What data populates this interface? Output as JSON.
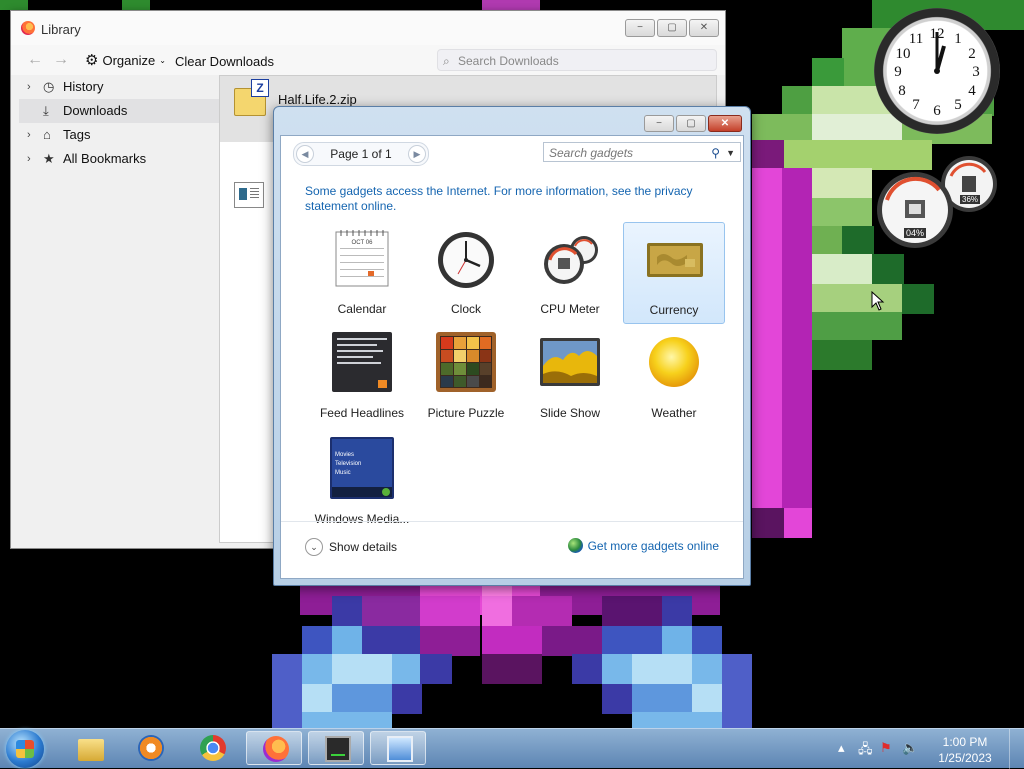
{
  "library": {
    "title": "Library",
    "window_controls": [
      "−",
      "▢",
      "✕"
    ],
    "toolbar": {
      "organize_label": "Organize",
      "clear_downloads_label": "Clear Downloads",
      "search_placeholder": "Search Downloads"
    },
    "sidebar": {
      "items": [
        {
          "label": "History",
          "icon": "clock-icon"
        },
        {
          "label": "Downloads",
          "icon": "download-icon"
        },
        {
          "label": "Tags",
          "icon": "tag-icon"
        },
        {
          "label": "All Bookmarks",
          "icon": "star-icon"
        }
      ],
      "selected": "Downloads"
    },
    "downloads": [
      {
        "name": "Half.Life.2.zip",
        "icon": "zip-file-icon"
      }
    ]
  },
  "gadgets": {
    "window_controls": [
      "−",
      "▢",
      "✕"
    ],
    "pager": {
      "label": "Page 1 of 1",
      "prev": "◀",
      "next": "▶"
    },
    "search_placeholder": "Search gadgets",
    "notice": "Some gadgets access the Internet.  For more information, see the privacy statement online.",
    "items": [
      {
        "label": "Calendar",
        "icon": "calendar-icon"
      },
      {
        "label": "Clock",
        "icon": "clock-icon"
      },
      {
        "label": "CPU Meter",
        "icon": "cpu-meter-icon"
      },
      {
        "label": "Currency",
        "icon": "currency-icon",
        "selected": true
      },
      {
        "label": "Feed Headlines",
        "icon": "feed-icon"
      },
      {
        "label": "Picture Puzzle",
        "icon": "puzzle-icon"
      },
      {
        "label": "Slide Show",
        "icon": "slideshow-icon"
      },
      {
        "label": "Weather",
        "icon": "weather-icon"
      },
      {
        "label": "Windows Media...",
        "icon": "media-center-icon"
      }
    ],
    "calendar_month": "OCT 06",
    "media_center_menu": [
      "Movies",
      "Television",
      "Music"
    ],
    "show_details_label": "Show details",
    "get_more_label": "Get more gadgets online"
  },
  "desktop_gadgets": {
    "clock_numbers": [
      "12",
      "1",
      "2",
      "3",
      "4",
      "5",
      "6",
      "7",
      "8",
      "9",
      "10",
      "11"
    ],
    "cpu_percent": "04%",
    "memory_percent": "36%"
  },
  "taskbar": {
    "apps": [
      "explorer",
      "media-player",
      "chrome",
      "firefox",
      "task-manager",
      "gadgets"
    ],
    "time": "1:00 PM",
    "date": "1/25/2023"
  }
}
